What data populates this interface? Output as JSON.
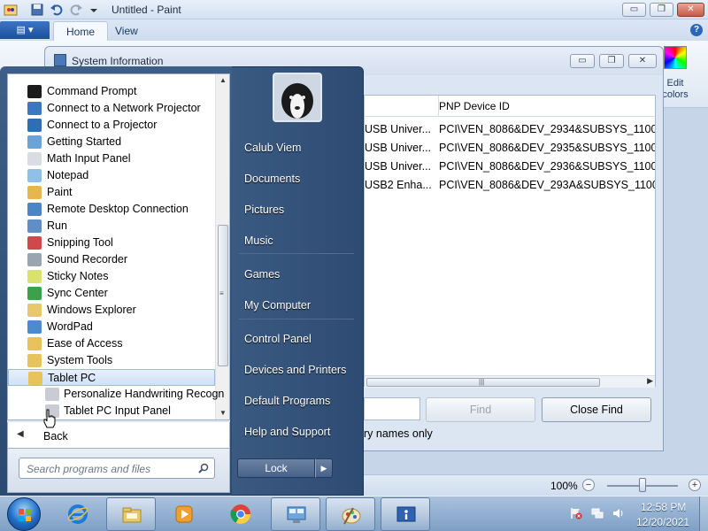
{
  "paint": {
    "title": "Untitled - Paint",
    "tabs": [
      "Home",
      "View"
    ],
    "help_glyph": "?",
    "edit_colors_label": "Edit colors",
    "zoom": "100%",
    "zoom_minus": "−",
    "zoom_plus": "+"
  },
  "window_buttons": {
    "minimize": "▭",
    "maximize": "❐",
    "close": "✕"
  },
  "sysinfo": {
    "title": "System Information",
    "column_header": "PNP Device ID",
    "rows": [
      {
        "name": "USB Univer...",
        "pnp": "PCI\\VEN_8086&DEV_2934&SUBSYS_11001"
      },
      {
        "name": "USB Univer...",
        "pnp": "PCI\\VEN_8086&DEV_2935&SUBSYS_11001"
      },
      {
        "name": "USB Univer...",
        "pnp": "PCI\\VEN_8086&DEV_2936&SUBSYS_11001"
      },
      {
        "name": "USB2 Enha...",
        "pnp": "PCI\\VEN_8086&DEV_293A&SUBSYS_11001"
      }
    ],
    "find_button": "Find",
    "close_find_button": "Close Find",
    "checkbox_label": "ry names only"
  },
  "start_menu": {
    "programs": [
      {
        "label": "Command Prompt",
        "icon": "command-prompt-icon",
        "color": "#1b1b1b"
      },
      {
        "label": "Connect to a Network Projector",
        "icon": "network-projector-icon",
        "color": "#3a78c2"
      },
      {
        "label": "Connect to a Projector",
        "icon": "projector-icon",
        "color": "#2f6db5"
      },
      {
        "label": "Getting Started",
        "icon": "getting-started-icon",
        "color": "#6aa3d8"
      },
      {
        "label": "Math Input Panel",
        "icon": "math-input-icon",
        "color": "#d9dde3"
      },
      {
        "label": "Notepad",
        "icon": "notepad-icon",
        "color": "#8fc0e8"
      },
      {
        "label": "Paint",
        "icon": "paint-icon",
        "color": "#e7b74d"
      },
      {
        "label": "Remote Desktop Connection",
        "icon": "remote-desktop-icon",
        "color": "#4a86c8"
      },
      {
        "label": "Run",
        "icon": "run-icon",
        "color": "#5f8fc4"
      },
      {
        "label": "Snipping Tool",
        "icon": "snipping-tool-icon",
        "color": "#d2474b"
      },
      {
        "label": "Sound Recorder",
        "icon": "sound-recorder-icon",
        "color": "#9aa5b1"
      },
      {
        "label": "Sticky Notes",
        "icon": "sticky-notes-icon",
        "color": "#d9e36b"
      },
      {
        "label": "Sync Center",
        "icon": "sync-center-icon",
        "color": "#3aa24a"
      },
      {
        "label": "Windows Explorer",
        "icon": "windows-explorer-icon",
        "color": "#e9c86a"
      },
      {
        "label": "WordPad",
        "icon": "wordpad-icon",
        "color": "#4d8bd0"
      },
      {
        "label": "Ease of Access",
        "icon": "folder-icon",
        "color": "#e8c35a"
      },
      {
        "label": "System Tools",
        "icon": "folder-icon",
        "color": "#e8c35a"
      },
      {
        "label": "Tablet PC",
        "icon": "folder-icon",
        "color": "#e8c35a",
        "selected": true
      },
      {
        "label": "Personalize Handwriting Recogn",
        "icon": "handwriting-icon",
        "color": "#c9ccd2",
        "sub": true
      },
      {
        "label": "Tablet PC Input Panel",
        "icon": "tablet-input-icon",
        "color": "#c9ccd2",
        "sub": true
      }
    ],
    "back_label": "Back",
    "search_placeholder": "Search programs and files",
    "right_links": [
      "Calub Viem",
      "Documents",
      "Pictures",
      "Music",
      "Games",
      "My Computer",
      "Control Panel",
      "Devices and Printers",
      "Default Programs",
      "Help and Support"
    ],
    "lock_label": "Lock",
    "lock_arrow": "▶"
  },
  "taskbar": {
    "time": "12:58 PM",
    "date": "12/20/2021",
    "pinned": [
      "internet-explorer-icon",
      "windows-explorer-icon",
      "media-player-icon",
      "chrome-icon",
      "system-info-icon",
      "paint-icon",
      "system-information-icon"
    ]
  },
  "colors": {
    "start_menu_right": "#2e4b72",
    "selection": "#cfe2f7",
    "taskbar": "#7e9fc5"
  }
}
